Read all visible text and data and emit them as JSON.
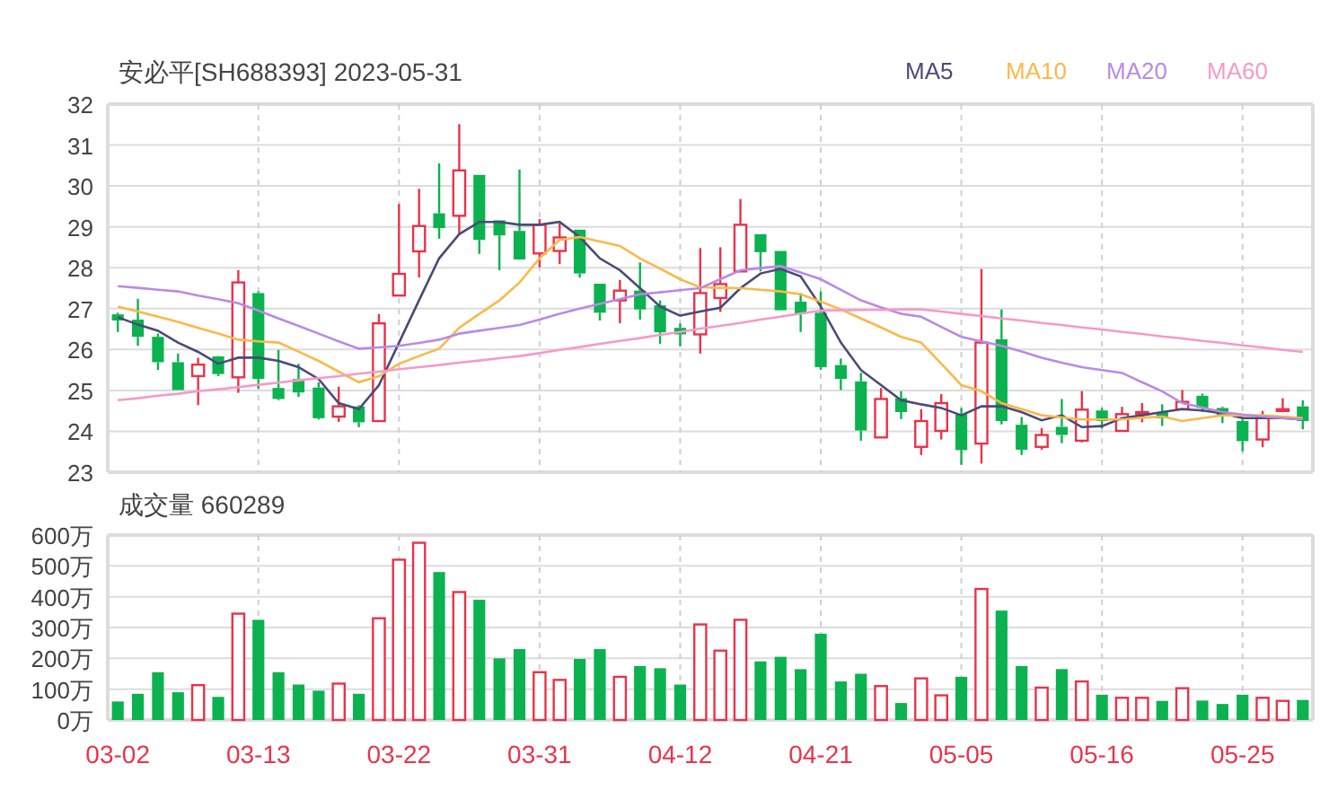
{
  "price_chart": {
    "title": "安必平[SH688393] 2023-05-31",
    "chart_data": {
      "type": "candlestick",
      "grid": true,
      "categories": [
        null,
        null,
        null,
        null,
        null,
        null,
        null,
        null,
        null,
        null,
        null,
        null,
        null,
        null,
        null,
        null,
        null,
        null,
        null,
        null,
        null,
        null,
        null,
        null,
        null,
        null,
        null,
        null,
        null,
        null,
        null,
        null,
        null,
        null,
        null,
        null,
        null,
        null,
        null,
        null,
        null,
        null,
        null,
        null,
        null,
        null,
        null,
        null,
        null,
        null,
        null,
        null,
        null,
        null,
        null,
        null,
        null,
        null,
        null,
        null
      ],
      "ylim": [
        23,
        32
      ],
      "yticks": [
        {
          "value": 23,
          "label": "23"
        },
        {
          "value": 24,
          "label": "24"
        },
        {
          "value": 25,
          "label": "25"
        },
        {
          "value": 26,
          "label": "26"
        },
        {
          "value": 27,
          "label": "27"
        },
        {
          "value": 28,
          "label": "28"
        },
        {
          "value": 29,
          "label": "29"
        },
        {
          "value": 30,
          "label": "30"
        },
        {
          "value": 31,
          "label": "31"
        },
        {
          "value": 32,
          "label": "32"
        }
      ],
      "series": [
        {
          "name": "MA5",
          "type": "line",
          "color": "#4b4a78",
          "values": [
            26.79,
            26.61,
            26.46,
            26.17,
            25.94,
            25.65,
            25.8,
            25.8,
            25.72,
            25.57,
            25.28,
            24.69,
            24.54,
            25.13,
            26.17,
            27.2,
            28.23,
            28.82,
            29.12,
            29.12,
            29.05,
            29.05,
            29.12,
            28.75,
            28.23,
            27.94,
            27.5,
            27.05,
            26.83,
            26.93,
            27.02,
            27.5,
            27.86,
            27.97,
            27.79,
            27.05,
            26.17,
            25.5,
            25.13,
            24.76,
            24.66,
            24.57,
            24.39,
            24.61,
            24.61,
            24.47,
            24.27,
            24.39,
            24.1,
            24.13,
            24.32,
            24.39,
            24.47,
            24.54,
            24.51,
            24.44,
            24.32,
            24.32,
            24.32,
            24.29
          ]
        },
        {
          "name": "MA10",
          "type": "line",
          "color": "#f9b94a",
          "values": [
            27.05,
            26.93,
            26.8,
            26.68,
            26.53,
            26.39,
            26.24,
            26.2,
            26.17,
            25.95,
            25.72,
            25.46,
            25.2,
            25.35,
            25.65,
            25.84,
            26.02,
            26.53,
            26.87,
            27.2,
            27.64,
            28.23,
            28.68,
            28.75,
            28.64,
            28.53,
            28.23,
            27.98,
            27.72,
            27.52,
            27.51,
            27.5,
            27.46,
            27.42,
            27.35,
            27.17,
            26.98,
            26.76,
            26.54,
            26.31,
            26.17,
            25.65,
            25.13,
            24.98,
            24.69,
            24.54,
            24.39,
            24.34,
            24.29,
            24.29,
            24.29,
            24.33,
            24.36,
            24.25,
            24.32,
            24.39,
            24.39,
            24.39,
            24.36,
            24.32
          ]
        },
        {
          "name": "MA20",
          "type": "line",
          "color": "#b98ae6",
          "values": [
            27.55,
            27.51,
            27.46,
            27.42,
            27.32,
            27.23,
            27.13,
            26.95,
            26.76,
            26.58,
            26.39,
            26.2,
            26.02,
            26.05,
            26.09,
            26.16,
            26.24,
            26.39,
            26.46,
            26.53,
            26.6,
            26.73,
            26.87,
            27.0,
            27.12,
            27.23,
            27.35,
            27.4,
            27.45,
            27.5,
            27.72,
            27.94,
            27.99,
            28.04,
            27.88,
            27.72,
            27.46,
            27.2,
            27.03,
            26.87,
            26.8,
            26.55,
            26.31,
            26.2,
            26.09,
            25.95,
            25.8,
            25.68,
            25.57,
            25.5,
            25.43,
            25.2,
            24.98,
            24.69,
            24.58,
            24.47,
            24.41,
            24.36,
            24.32,
            24.29
          ]
        },
        {
          "name": "MA60",
          "type": "line",
          "color": "#f59ac8",
          "values": [
            24.76,
            24.81,
            24.87,
            24.92,
            24.98,
            25.03,
            25.08,
            25.14,
            25.19,
            25.25,
            25.3,
            25.35,
            25.41,
            25.46,
            25.52,
            25.57,
            25.62,
            25.68,
            25.73,
            25.79,
            25.84,
            25.91,
            25.99,
            26.06,
            26.14,
            26.21,
            26.28,
            26.36,
            26.43,
            26.51,
            26.58,
            26.65,
            26.73,
            26.8,
            26.88,
            26.95,
            26.96,
            26.97,
            26.97,
            26.98,
            26.98,
            26.93,
            26.87,
            26.82,
            26.76,
            26.71,
            26.65,
            26.6,
            26.54,
            26.49,
            26.43,
            26.38,
            26.32,
            26.27,
            26.21,
            26.16,
            26.1,
            26.05,
            25.99,
            25.94
          ]
        }
      ],
      "ohlc": [
        [
          26.86,
          26.9,
          26.43,
          26.71
        ],
        [
          26.73,
          27.24,
          26.09,
          26.31
        ],
        [
          26.31,
          26.39,
          25.5,
          25.69
        ],
        [
          25.69,
          25.9,
          25.01,
          25.01
        ],
        [
          25.35,
          25.8,
          24.64,
          25.63
        ],
        [
          25.83,
          25.84,
          25.35,
          25.4
        ],
        [
          25.32,
          27.94,
          24.94,
          27.64
        ],
        [
          27.38,
          27.42,
          25.04,
          25.28
        ],
        [
          25.06,
          25.99,
          24.76,
          24.79
        ],
        [
          25.28,
          25.65,
          24.84,
          24.95
        ],
        [
          25.07,
          25.2,
          24.29,
          24.32
        ],
        [
          24.36,
          25.09,
          24.23,
          24.61
        ],
        [
          24.61,
          24.64,
          24.1,
          24.22
        ],
        [
          24.25,
          26.87,
          24.25,
          26.64
        ],
        [
          27.32,
          29.56,
          27.32,
          27.85
        ],
        [
          28.4,
          29.93,
          27.76,
          29.02
        ],
        [
          29.33,
          30.55,
          28.71,
          28.97
        ],
        [
          29.27,
          31.51,
          28.82,
          30.38
        ],
        [
          30.27,
          30.27,
          28.34,
          28.68
        ],
        [
          29.16,
          29.16,
          27.94,
          28.79
        ],
        [
          28.9,
          30.4,
          28.2,
          28.2
        ],
        [
          28.35,
          29.19,
          28.01,
          29.05
        ],
        [
          28.41,
          29.08,
          28.09,
          28.74
        ],
        [
          28.93,
          28.93,
          27.76,
          27.86
        ],
        [
          27.61,
          27.61,
          26.71,
          26.9
        ],
        [
          27.2,
          27.7,
          26.64,
          27.44
        ],
        [
          27.44,
          28.13,
          26.73,
          26.98
        ],
        [
          27.08,
          27.2,
          26.14,
          26.42
        ],
        [
          26.53,
          26.64,
          26.08,
          26.37
        ],
        [
          26.37,
          28.48,
          25.9,
          27.38
        ],
        [
          27.26,
          28.5,
          26.92,
          27.6
        ],
        [
          27.91,
          29.68,
          27.91,
          29.05
        ],
        [
          28.82,
          28.82,
          27.91,
          28.38
        ],
        [
          28.41,
          28.41,
          26.96,
          26.96
        ],
        [
          27.17,
          27.38,
          26.43,
          26.87
        ],
        [
          26.9,
          27.42,
          25.5,
          25.57
        ],
        [
          25.62,
          25.78,
          25.01,
          25.28
        ],
        [
          25.22,
          25.43,
          23.77,
          24.02
        ],
        [
          23.85,
          25.06,
          23.85,
          24.79
        ],
        [
          24.81,
          24.98,
          24.3,
          24.47
        ],
        [
          23.62,
          24.54,
          23.42,
          24.25
        ],
        [
          24.01,
          24.91,
          23.8,
          24.69
        ],
        [
          24.42,
          24.57,
          23.18,
          23.54
        ],
        [
          23.7,
          27.97,
          23.21,
          26.17
        ],
        [
          26.25,
          26.98,
          24.17,
          24.25
        ],
        [
          24.16,
          24.35,
          23.42,
          23.55
        ],
        [
          23.62,
          24.08,
          23.55,
          23.91
        ],
        [
          24.11,
          24.79,
          23.71,
          23.91
        ],
        [
          23.77,
          24.98,
          23.73,
          24.53
        ],
        [
          24.51,
          24.57,
          24.07,
          24.25
        ],
        [
          24.01,
          24.6,
          23.99,
          24.42
        ],
        [
          24.42,
          24.69,
          24.22,
          24.47
        ],
        [
          24.47,
          24.66,
          24.13,
          24.32
        ],
        [
          24.54,
          25.01,
          24.53,
          24.72
        ],
        [
          24.87,
          24.92,
          24.47,
          24.57
        ],
        [
          24.57,
          24.6,
          24.2,
          24.39
        ],
        [
          24.25,
          24.29,
          23.51,
          23.76
        ],
        [
          23.8,
          24.5,
          23.61,
          24.35
        ],
        [
          24.5,
          24.81,
          24.5,
          24.54
        ],
        [
          24.61,
          24.76,
          24.05,
          24.25
        ]
      ]
    }
  },
  "volume_chart": {
    "chart_data": {
      "type": "bar",
      "title": "成交量 660289",
      "grid": true,
      "categories": [
        "03-02",
        null,
        null,
        null,
        null,
        null,
        null,
        "03-13",
        null,
        null,
        null,
        null,
        null,
        null,
        "03-22",
        null,
        null,
        null,
        null,
        null,
        null,
        "03-31",
        null,
        null,
        null,
        null,
        null,
        null,
        "04-12",
        null,
        null,
        null,
        null,
        null,
        null,
        "04-21",
        null,
        null,
        null,
        null,
        null,
        null,
        "05-05",
        null,
        null,
        null,
        null,
        null,
        null,
        "05-16",
        null,
        null,
        null,
        null,
        null,
        null,
        "05-25",
        null,
        null,
        null
      ],
      "ylim": [
        0,
        600
      ],
      "yticks": [
        {
          "value": 0,
          "label": "0万"
        },
        {
          "value": 100,
          "label": "100万"
        },
        {
          "value": 200,
          "label": "200万"
        },
        {
          "value": 300,
          "label": "300万"
        },
        {
          "value": 400,
          "label": "400万"
        },
        {
          "value": 500,
          "label": "500万"
        },
        {
          "value": 600,
          "label": "600万"
        }
      ],
      "values": [
        60,
        85,
        155,
        90,
        113,
        75,
        345,
        325,
        155,
        115,
        95,
        118,
        85,
        330,
        520,
        575,
        480,
        415,
        390,
        200,
        230,
        155,
        130,
        198,
        230,
        140,
        175,
        168,
        115,
        310,
        225,
        325,
        190,
        205,
        165,
        280,
        125,
        150,
        110,
        55,
        135,
        80,
        140,
        425,
        355,
        175,
        105,
        165,
        125,
        82,
        72,
        72,
        62,
        103,
        63,
        52,
        82,
        72,
        62,
        65
      ]
    }
  }
}
